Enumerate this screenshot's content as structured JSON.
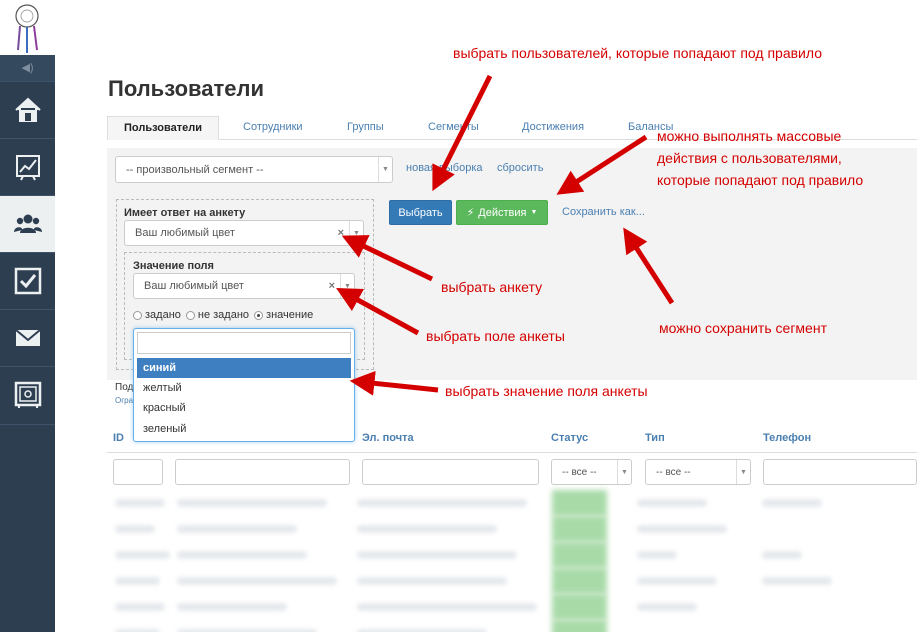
{
  "sidebar": {
    "volume_label": "◀)",
    "items": [
      {
        "icon": "home-icon"
      },
      {
        "icon": "chart-icon"
      },
      {
        "icon": "users-icon"
      },
      {
        "icon": "checkbox-icon"
      },
      {
        "icon": "mail-icon"
      },
      {
        "icon": "safe-icon"
      }
    ]
  },
  "page": {
    "title": "Пользователи"
  },
  "tabs": [
    "Пользователи",
    "Сотрудники",
    "Группы",
    "Сегменты",
    "Достижения",
    "Балансы"
  ],
  "filter": {
    "segment_select": "-- произвольный сегмент --",
    "new_selection_link": "новая выборка",
    "reset_link": "сбросить",
    "select_button": "Выбрать",
    "actions_button": "Действия",
    "save_as_link": "Сохранить как...",
    "survey_label": "Имеет ответ на анкету",
    "survey_value": "Ваш любимый цвет",
    "field_value_label": "Значение поля",
    "field_value": "Ваш любимый цвет",
    "radios": [
      {
        "label": "задано",
        "checked": false
      },
      {
        "label": "не задано",
        "checked": false
      },
      {
        "label": "значение",
        "checked": true
      }
    ],
    "dropdown_options": [
      "синий",
      "желтый",
      "красный",
      "зеленый"
    ],
    "highlighted_option": "синий",
    "below_text": "Под",
    "below_sub": "Огра"
  },
  "table": {
    "headers": [
      "ID",
      "Эл. почта",
      "Статус",
      "Тип",
      "Телефон"
    ],
    "status_filter": "-- все --",
    "type_filter": "-- все --"
  },
  "annotations": [
    "выбрать пользователей, которые попадают под правило",
    "можно выполнять массовые",
    "действия с пользователями,",
    "которые попадают под правило",
    "выбрать анкету",
    "выбрать поле анкеты",
    "выбрать значение поля анкеты",
    "можно сохранить сегмент"
  ],
  "colors": {
    "sidebar": "#2c3e50",
    "primary": "#337ab7",
    "success": "#5cb85c",
    "annotation": "#d40000",
    "link": "#4a7fb1"
  }
}
